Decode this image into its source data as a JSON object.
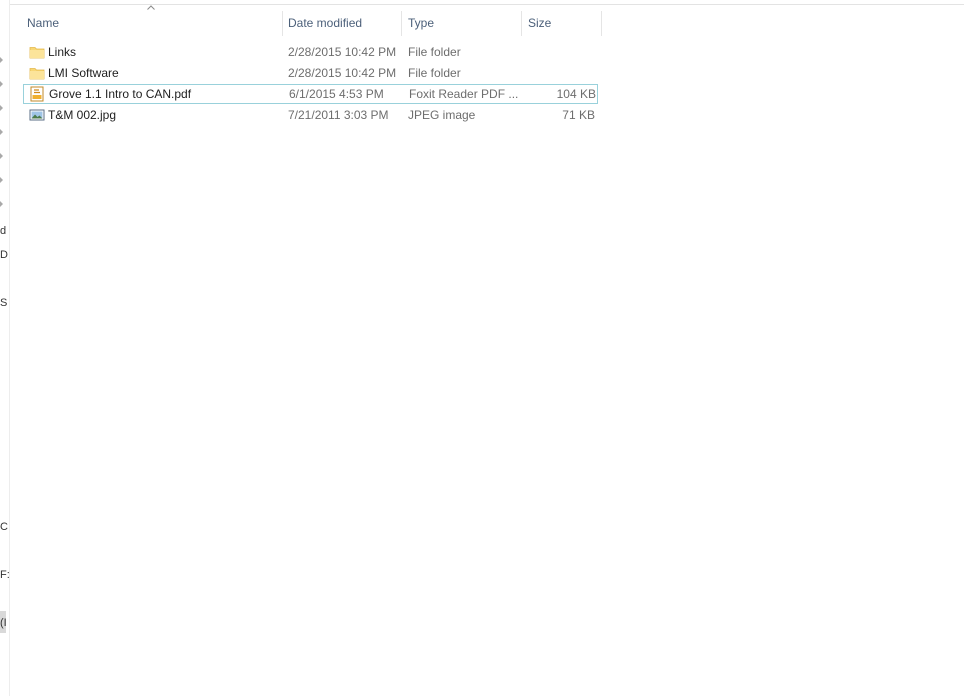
{
  "columns": {
    "name": "Name",
    "date": "Date modified",
    "type": "Type",
    "size": "Size"
  },
  "files": [
    {
      "name": "Links",
      "date": "2/28/2015 10:42 PM",
      "type": "File folder",
      "size": "",
      "icon": "folder-icon"
    },
    {
      "name": "LMI Software",
      "date": "2/28/2015 10:42 PM",
      "type": "File folder",
      "size": "",
      "icon": "folder-icon"
    },
    {
      "name": "Grove 1.1 Intro to CAN.pdf",
      "date": "6/1/2015 4:53 PM",
      "type": "Foxit Reader PDF ...",
      "size": "104 KB",
      "icon": "pdf-file-icon"
    },
    {
      "name": "T&M 002.jpg",
      "date": "7/21/2011 3:03 PM",
      "type": "JPEG image",
      "size": "71 KB",
      "icon": "image-file-icon"
    }
  ],
  "nav_fragments": [
    "d",
    "D",
    "S",
    "C",
    "F:",
    "(I"
  ],
  "colors": {
    "header_text": "#4c607a",
    "focus_border": "#99d1db",
    "folder_yellow": "#f8d775"
  }
}
